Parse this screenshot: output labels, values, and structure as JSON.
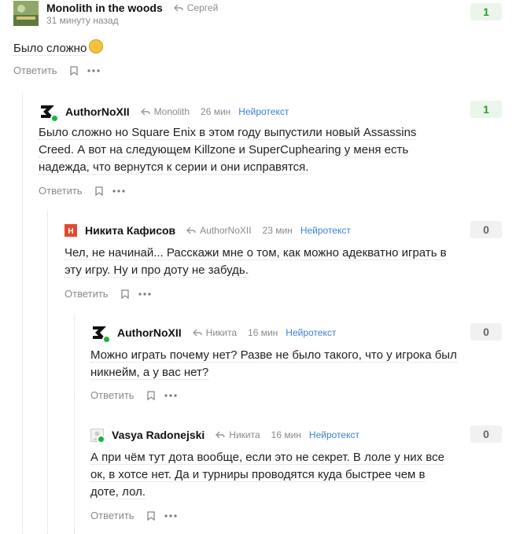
{
  "comments": [
    {
      "author": "Monolith in the woods",
      "reply_to": "Сергей",
      "time": "31 минуту назад",
      "badge": "",
      "text": "Было сложно",
      "score": "1"
    },
    {
      "author": "AuthorNoXII",
      "reply_to": "Monolith",
      "time": "26 мин",
      "badge": "Нейротекст",
      "text": "Было сложно но Square Enix в этом году выпустили новый Assassins Creed. А вот на следующем Killzone и SuperCuphearing у меня есть надежда, что вернутся к серии и они исправятся.",
      "score": "1"
    },
    {
      "author": "Никита Кафисов",
      "reply_to": "AuthorNoXII",
      "time": "23 мин",
      "badge": "Нейротекст",
      "text": "Чел, не начинай... Расскажи мне о том, как можно адекватно играть в эту игру. Ну и про доту не забудь.",
      "score": "0"
    },
    {
      "author": "AuthorNoXII",
      "reply_to": "Никита",
      "time": "16 мин",
      "badge": "Нейротекст",
      "text": "Можно играть почему нет? Разве не было такого, что у игрока был никнейм, а у вас нет?",
      "score": "0"
    },
    {
      "author": "Vasya Radonejski",
      "reply_to": "Никита",
      "time": "16 мин",
      "badge": "Нейротекст",
      "text": "А при чём тут дота вообще, если это не секрет. В лоле у них все ок, в хотсе нет. Да и турниры проводятся куда быстрее чем в доте, лол.",
      "score": "0"
    }
  ],
  "actions": {
    "reply_label": "Ответить"
  },
  "icons": {
    "bookmark": "bookmark-icon",
    "more": "more-dots-icon",
    "reply_arrow": "reply-arrow-icon",
    "online": "online-dot"
  },
  "colors": {
    "badge": "#3b7fd9",
    "score_positive": "#2a9d2a",
    "online": "#19b33d"
  }
}
